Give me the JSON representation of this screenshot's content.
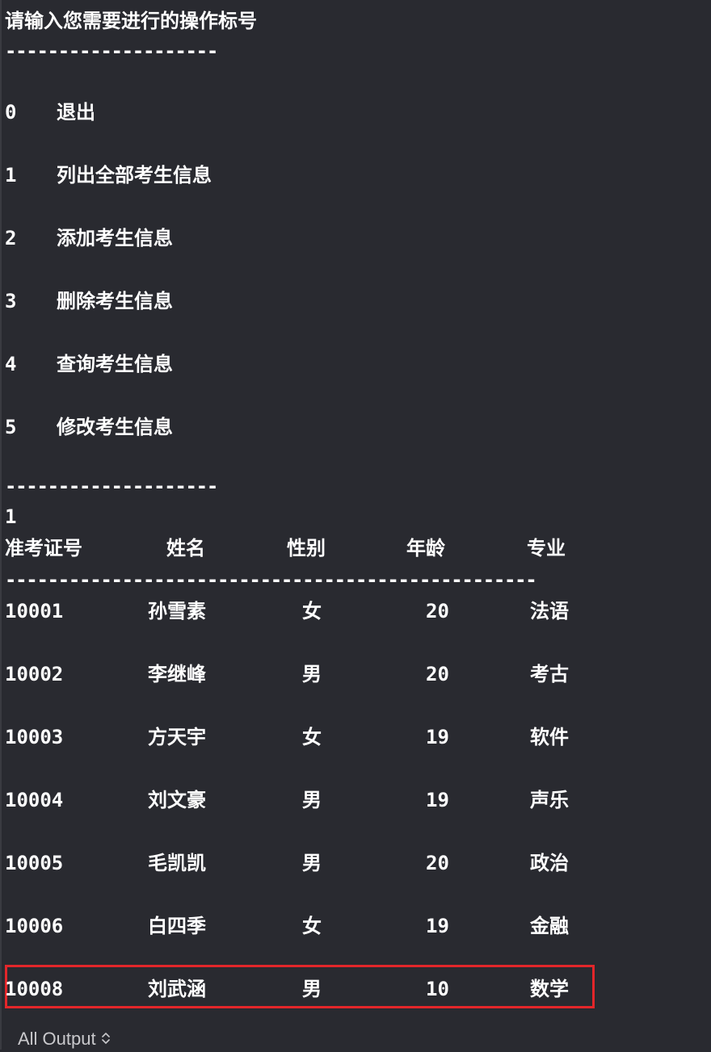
{
  "console": {
    "prompt": "请输入您需要进行的操作标号",
    "separator_short": "--------------------",
    "menu": [
      {
        "num": "0",
        "label": "退出"
      },
      {
        "num": "1",
        "label": "列出全部考生信息"
      },
      {
        "num": "2",
        "label": "添加考生信息"
      },
      {
        "num": "3",
        "label": "删除考生信息"
      },
      {
        "num": "4",
        "label": "查询考生信息"
      },
      {
        "num": "5",
        "label": "修改考生信息"
      }
    ],
    "input_value": "1",
    "table": {
      "headers": [
        "准考证号",
        "姓名",
        "性别",
        "年龄",
        "专业"
      ],
      "separator_long": "--------------------------------------------------",
      "rows": [
        [
          "10001",
          "孙雪素",
          "女",
          "20",
          "法语"
        ],
        [
          "10002",
          "李继峰",
          "男",
          "20",
          "考古"
        ],
        [
          "10003",
          "方天宇",
          "女",
          "19",
          "软件"
        ],
        [
          "10004",
          "刘文豪",
          "男",
          "19",
          "声乐"
        ],
        [
          "10005",
          "毛凯凯",
          "男",
          "20",
          "政治"
        ],
        [
          "10006",
          "白四季",
          "女",
          "19",
          "金融"
        ],
        [
          "10008",
          "刘武涵",
          "男",
          "10",
          "数学"
        ]
      ],
      "highlighted_row": 7
    }
  },
  "footer": {
    "filter_label": "All Output",
    "filter_icon": "up-down-chevron-icon"
  },
  "colors": {
    "background": "#292a30",
    "text": "#ffffff",
    "highlight_border": "#e3262a"
  }
}
